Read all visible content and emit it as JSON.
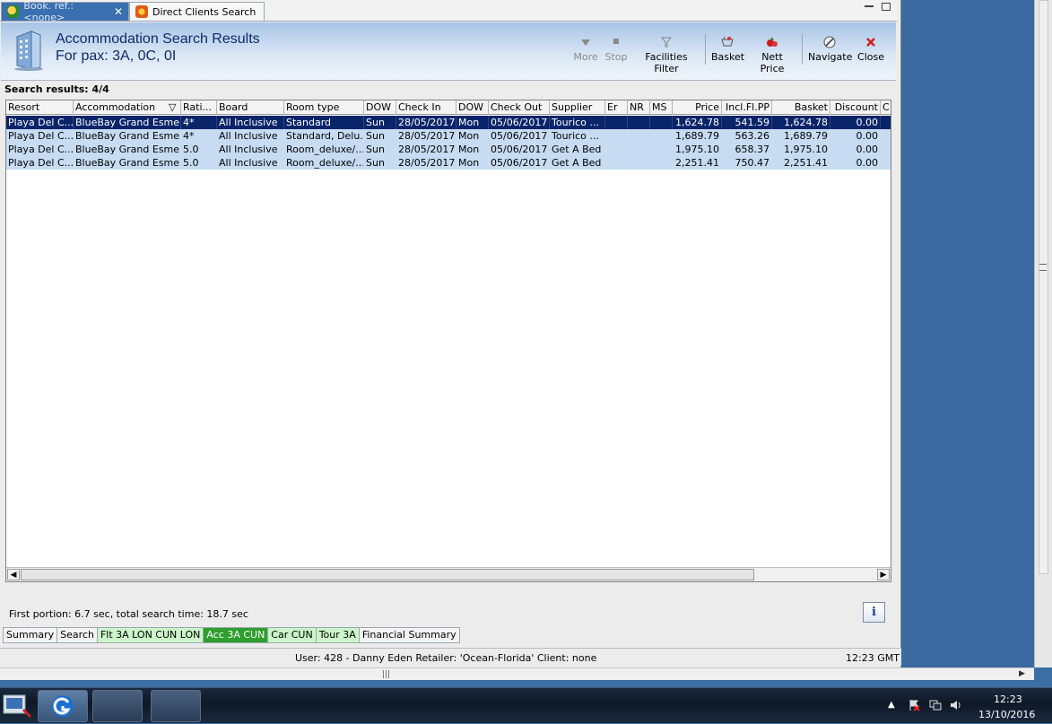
{
  "tabs": {
    "book_label": "Book. ref.: <none>",
    "book_close": "✕",
    "direct_label": "Direct Clients Search"
  },
  "header": {
    "title": "Accommodation Search Results",
    "pax": "For pax: 3A, 0C, 0I"
  },
  "toolbar": {
    "more": "More",
    "stop": "Stop",
    "facilities": "Facilities Filter",
    "basket": "Basket",
    "nett": "Nett Price",
    "navigate": "Navigate",
    "close": "Close"
  },
  "results_label": "Search results: 4/4",
  "grid": {
    "columns": [
      "Resort",
      "Accommodation",
      "Rati...",
      "Board",
      "Room type",
      "DOW",
      "Check In",
      "DOW",
      "Check Out",
      "Supplier",
      "Er",
      "NR",
      "MS",
      "Price",
      "Incl.Fl.PP",
      "Basket",
      "Discount",
      "C"
    ],
    "rows": [
      [
        "Playa Del C...",
        "BlueBay Grand Esmer...",
        "4*",
        "All Inclusive",
        "Standard",
        "Sun",
        "28/05/2017",
        "Mon",
        "05/06/2017",
        "Tourico ...",
        "",
        "",
        "",
        "1,624.78",
        "541.59",
        "1,624.78",
        "0.00",
        ""
      ],
      [
        "Playa Del C...",
        "BlueBay Grand Esmer...",
        "4*",
        "All Inclusive",
        "Standard, Delu...",
        "Sun",
        "28/05/2017",
        "Mon",
        "05/06/2017",
        "Tourico ...",
        "",
        "",
        "",
        "1,689.79",
        "563.26",
        "1,689.79",
        "0.00",
        ""
      ],
      [
        "Playa Del C...",
        "BlueBay Grand Esmer...",
        "5.0",
        "All Inclusive",
        "Room_deluxe/...",
        "Sun",
        "28/05/2017",
        "Mon",
        "05/06/2017",
        "Get A Bed",
        "",
        "",
        "",
        "1,975.10",
        "658.37",
        "1,975.10",
        "0.00",
        ""
      ],
      [
        "Playa Del C...",
        "BlueBay Grand Esmer...",
        "5.0",
        "All Inclusive",
        "Room_deluxe/...",
        "Sun",
        "28/05/2017",
        "Mon",
        "05/06/2017",
        "Get A Bed",
        "",
        "",
        "",
        "2,251.41",
        "750.47",
        "2,251.41",
        "0.00",
        ""
      ]
    ],
    "selected_row": 0
  },
  "timing": "First portion: 6.7 sec, total search time: 18.7 sec",
  "info_button": "i",
  "bottom_tabs": [
    {
      "label": "Summary",
      "style": "plain"
    },
    {
      "label": "Search",
      "style": "plain"
    },
    {
      "label": "Flt 3A LON CUN LON",
      "style": "green"
    },
    {
      "label": "Acc 3A CUN",
      "style": "active"
    },
    {
      "label": "Car CUN",
      "style": "green"
    },
    {
      "label": "Tour 3A",
      "style": "green"
    },
    {
      "label": "Financial Summary",
      "style": "plain"
    }
  ],
  "status": {
    "user": "User: 428 - Danny Eden     Retailer: 'Ocean-Florida'     Client: none",
    "time": "12:23 GMT"
  },
  "taskbar": {
    "clock_time": "12:23",
    "clock_date": "13/10/2016"
  },
  "colors": {
    "selection": "#0a246a",
    "row_highlight": "#c7dcf3",
    "active_tab": "#2e9e2e",
    "header_title": "#0d2b6b"
  }
}
